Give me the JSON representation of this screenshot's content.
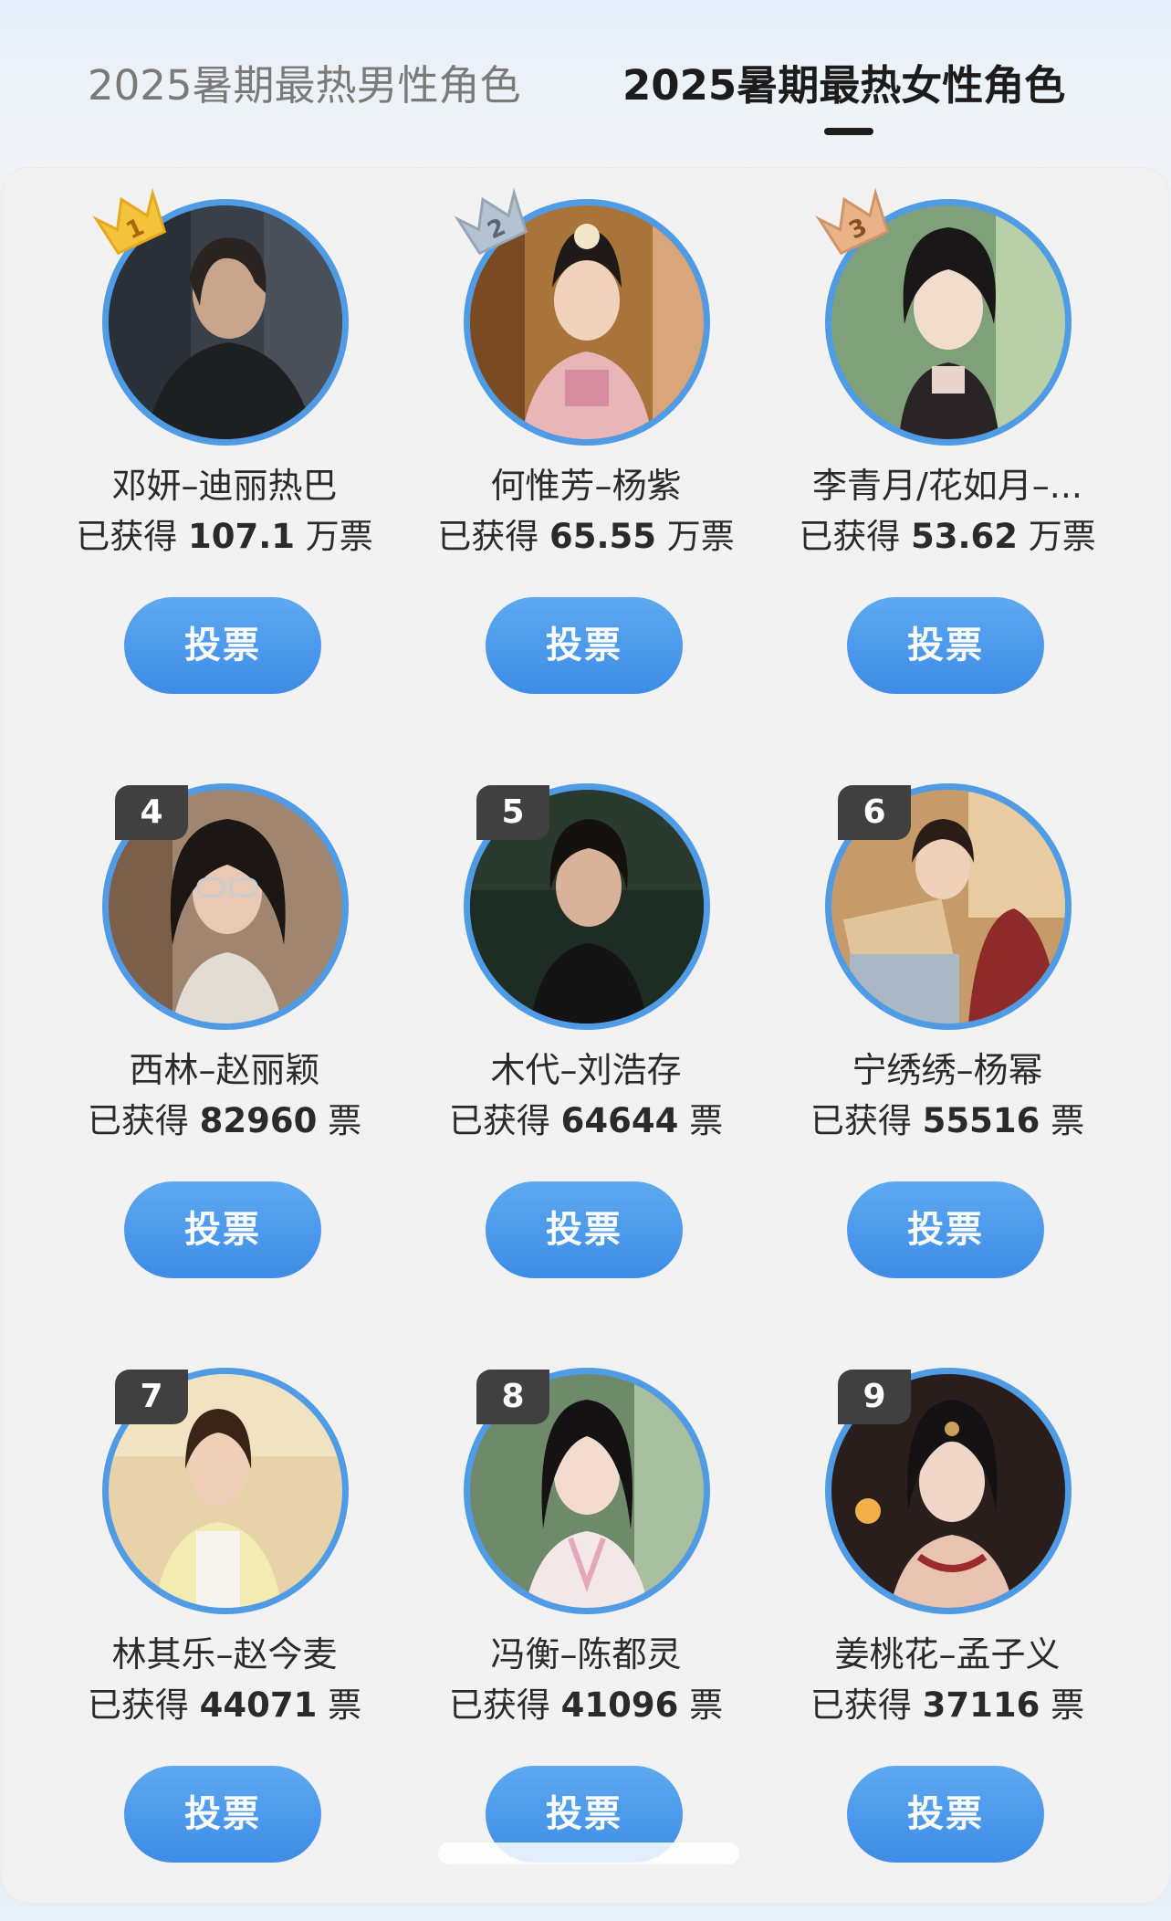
{
  "tabs": [
    {
      "label": "2025暑期最热男性角色",
      "active": false
    },
    {
      "label": "2025暑期最热女性角色",
      "active": true
    }
  ],
  "colors": {
    "accent": "#4f9be6",
    "button_top": "#5ea9f1",
    "button_bottom": "#3d8ce6",
    "gold": "#f5c33b",
    "silver": "#b4c2d1",
    "bronze": "#e9b38a"
  },
  "vote_label": "投票",
  "characters": [
    {
      "rank": "1",
      "badge": "crown-gold",
      "name": "邓妍–迪丽热巴",
      "votes_prefix": "已获得",
      "votes_number": "107.1",
      "votes_unit": "万票"
    },
    {
      "rank": "2",
      "badge": "crown-silver",
      "name": "何惟芳–杨紫",
      "votes_prefix": "已获得",
      "votes_number": "65.55",
      "votes_unit": "万票"
    },
    {
      "rank": "3",
      "badge": "crown-bronze",
      "name": "李青月/花如月–...",
      "votes_prefix": "已获得",
      "votes_number": "53.62",
      "votes_unit": "万票"
    },
    {
      "rank": "4",
      "badge": "rank-number",
      "name": "西林–赵丽颖",
      "votes_prefix": "已获得",
      "votes_number": "82960",
      "votes_unit": "票"
    },
    {
      "rank": "5",
      "badge": "rank-number",
      "name": "木代–刘浩存",
      "votes_prefix": "已获得",
      "votes_number": "64644",
      "votes_unit": "票"
    },
    {
      "rank": "6",
      "badge": "rank-number",
      "name": "宁绣绣–杨幂",
      "votes_prefix": "已获得",
      "votes_number": "55516",
      "votes_unit": "票"
    },
    {
      "rank": "7",
      "badge": "rank-number",
      "name": "林其乐–赵今麦",
      "votes_prefix": "已获得",
      "votes_number": "44071",
      "votes_unit": "票"
    },
    {
      "rank": "8",
      "badge": "rank-number",
      "name": "冯衡–陈都灵",
      "votes_prefix": "已获得",
      "votes_number": "41096",
      "votes_unit": "票"
    },
    {
      "rank": "9",
      "badge": "rank-number",
      "name": "姜桃花–孟子义",
      "votes_prefix": "已获得",
      "votes_number": "37116",
      "votes_unit": "票"
    }
  ]
}
